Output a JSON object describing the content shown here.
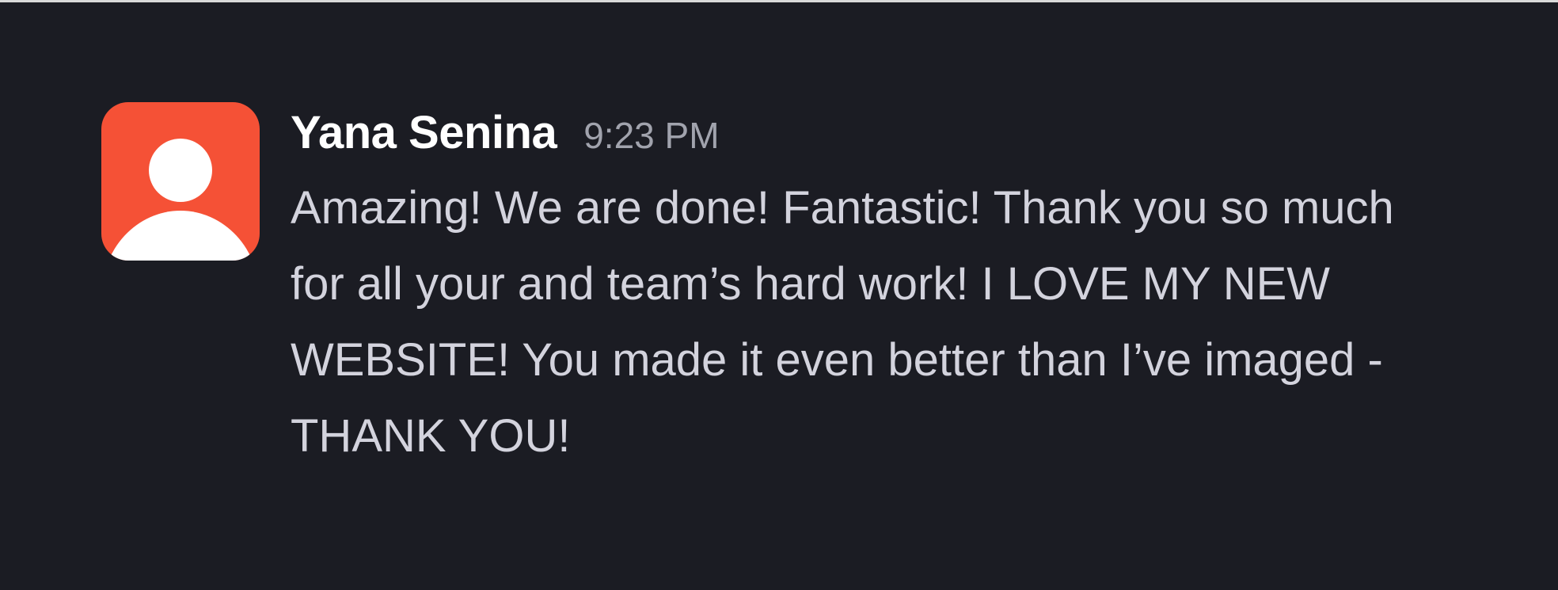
{
  "message": {
    "author": "Yana Senina",
    "timestamp": "9:23 PM",
    "text": "Amazing! We are done! Fantastic! Thank you so much for all your and team’s hard work! I LOVE MY NEW WEBSITE! You made it even better than I’ve imaged - THANK YOU!",
    "avatar_icon": "user-silhouette-icon",
    "avatar_color": "#f55136"
  }
}
